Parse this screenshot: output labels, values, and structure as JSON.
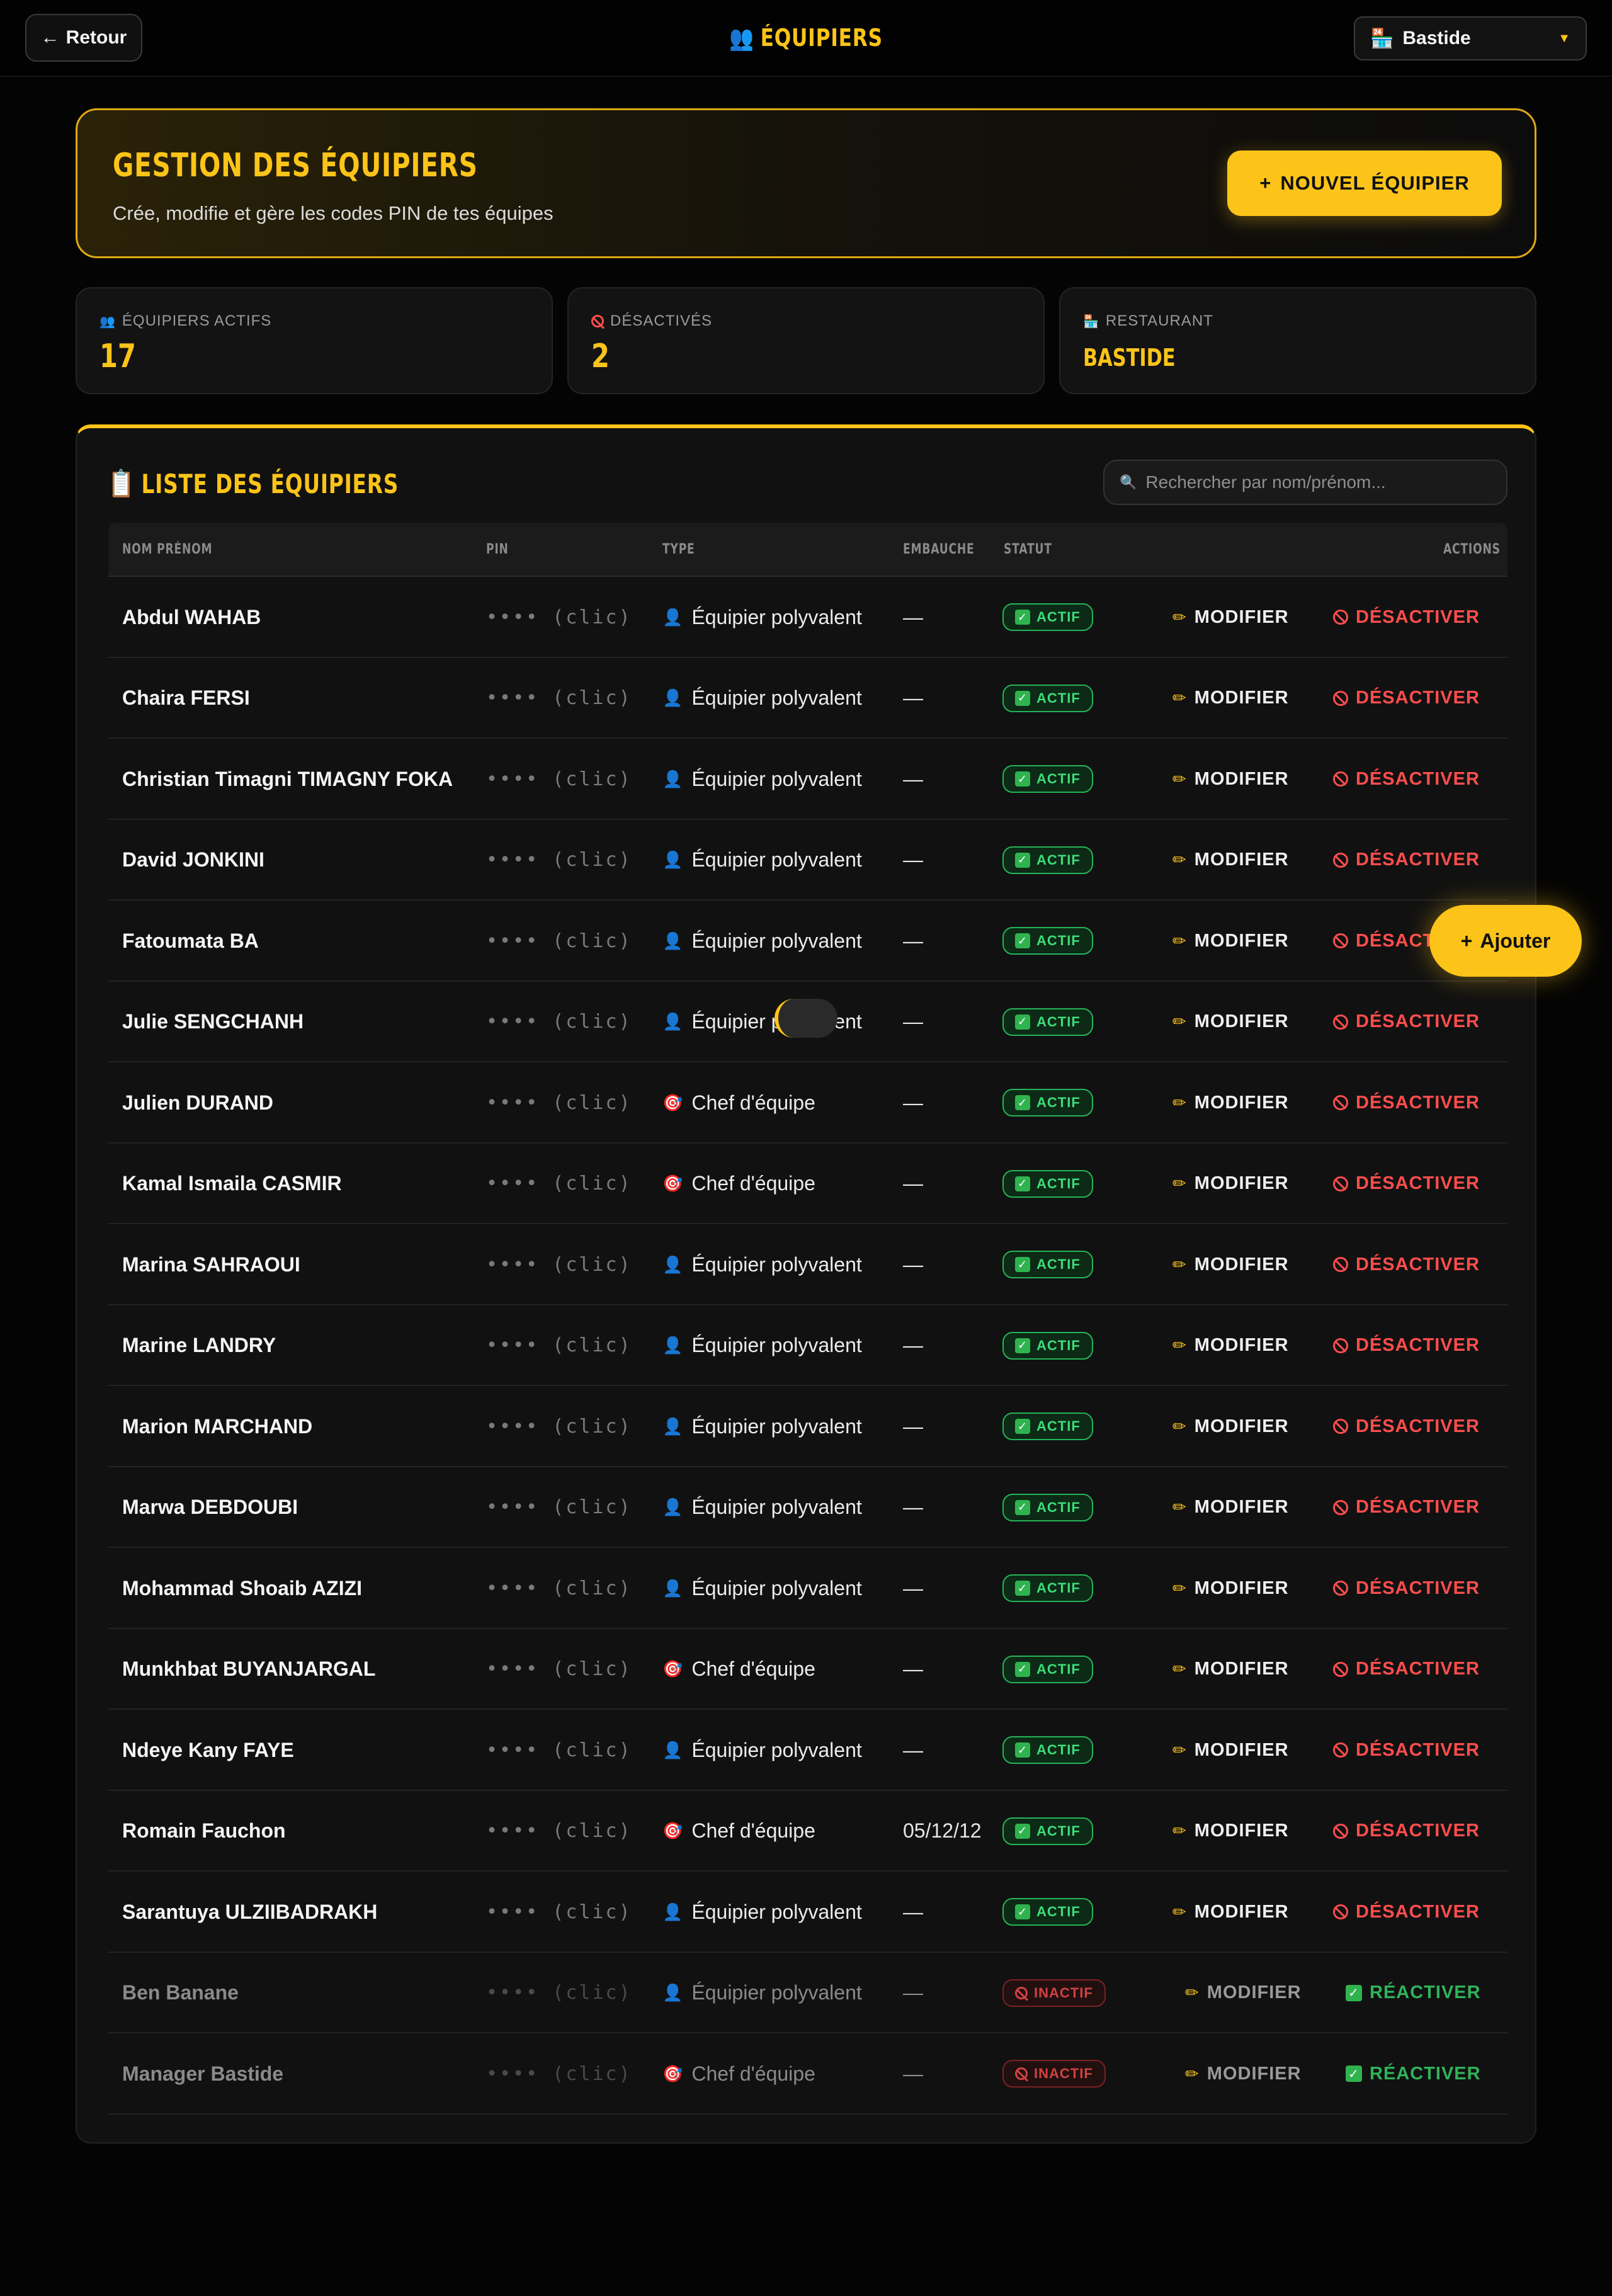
{
  "topbar": {
    "back_label": "Retour",
    "title": "ÉQUIPIERS",
    "restaurant_selected": "Bastide"
  },
  "hero": {
    "title": "GESTION DES ÉQUIPIERS",
    "subtitle": "Crée, modifie et gère les codes PIN de tes équipes",
    "new_button": "NOUVEL ÉQUIPIER"
  },
  "stats": {
    "active_label": "ÉQUIPIERS ACTIFS",
    "active_value": "17",
    "disabled_label": "DÉSACTIVÉS",
    "disabled_value": "2",
    "restaurant_label": "RESTAURANT",
    "restaurant_value": "BASTIDE"
  },
  "list": {
    "title": "LISTE DES ÉQUIPIERS",
    "search_placeholder": "Rechercher par nom/prénom...",
    "columns": [
      "NOM PRÉNOM",
      "PIN",
      "TYPE",
      "EMBAUCHE",
      "STATUT",
      "ACTIONS"
    ],
    "pin_mask": "•••• (clic)",
    "edit_label": "MODIFIER",
    "disable_label": "DÉSACTIVER",
    "reactivate_label": "RÉACTIVER",
    "active_badge": "ACTIF",
    "inactive_badge": "INACTIF",
    "rows": [
      {
        "name": "Abdul WAHAB",
        "type": "Équipier polyvalent",
        "type_icon": "person-icon",
        "hire": "—",
        "active": true
      },
      {
        "name": "Chaira FERSI",
        "type": "Équipier polyvalent",
        "type_icon": "person-icon",
        "hire": "—",
        "active": true
      },
      {
        "name": "Christian Timagni TIMAGNY FOKA",
        "type": "Équipier polyvalent",
        "type_icon": "person-icon",
        "hire": "—",
        "active": true
      },
      {
        "name": "David JONKINI",
        "type": "Équipier polyvalent",
        "type_icon": "person-icon",
        "hire": "—",
        "active": true
      },
      {
        "name": "Fatoumata BA",
        "type": "Équipier polyvalent",
        "type_icon": "person-icon",
        "hire": "—",
        "active": true
      },
      {
        "name": "Julie SENGCHANH",
        "type": "Équipier polyvalent",
        "type_icon": "person-icon",
        "hire": "—",
        "active": true
      },
      {
        "name": "Julien DURAND",
        "type": "Chef d'équipe",
        "type_icon": "target-icon",
        "hire": "—",
        "active": true
      },
      {
        "name": "Kamal Ismaila CASMIR",
        "type": "Chef d'équipe",
        "type_icon": "target-icon",
        "hire": "—",
        "active": true
      },
      {
        "name": "Marina SAHRAOUI",
        "type": "Équipier polyvalent",
        "type_icon": "person-icon",
        "hire": "—",
        "active": true
      },
      {
        "name": "Marine LANDRY",
        "type": "Équipier polyvalent",
        "type_icon": "person-icon",
        "hire": "—",
        "active": true
      },
      {
        "name": "Marion MARCHAND",
        "type": "Équipier polyvalent",
        "type_icon": "person-icon",
        "hire": "—",
        "active": true
      },
      {
        "name": "Marwa DEBDOUBI",
        "type": "Équipier polyvalent",
        "type_icon": "person-icon",
        "hire": "—",
        "active": true
      },
      {
        "name": "Mohammad Shoaib AZIZI",
        "type": "Équipier polyvalent",
        "type_icon": "person-icon",
        "hire": "—",
        "active": true
      },
      {
        "name": "Munkhbat BUYANJARGAL",
        "type": "Chef d'équipe",
        "type_icon": "target-icon",
        "hire": "—",
        "active": true
      },
      {
        "name": "Ndeye Kany FAYE",
        "type": "Équipier polyvalent",
        "type_icon": "person-icon",
        "hire": "—",
        "active": true
      },
      {
        "name": "Romain Fauchon",
        "type": "Chef d'équipe",
        "type_icon": "target-icon",
        "hire": "05/12/12",
        "active": true
      },
      {
        "name": "Sarantuya ULZIIBADRAKH",
        "type": "Équipier polyvalent",
        "type_icon": "person-icon",
        "hire": "—",
        "active": true
      },
      {
        "name": "Ben Banane",
        "type": "Équipier polyvalent",
        "type_icon": "person-icon",
        "hire": "—",
        "active": false
      },
      {
        "name": "Manager Bastide",
        "type": "Chef d'équipe",
        "type_icon": "target-icon",
        "hire": "—",
        "active": false
      }
    ]
  },
  "fab": {
    "label": "Ajouter"
  },
  "colors": {
    "accent": "#fcc419",
    "active_green": "#3ddc7a",
    "danger_red": "#ff4d4d",
    "background": "#040404"
  }
}
